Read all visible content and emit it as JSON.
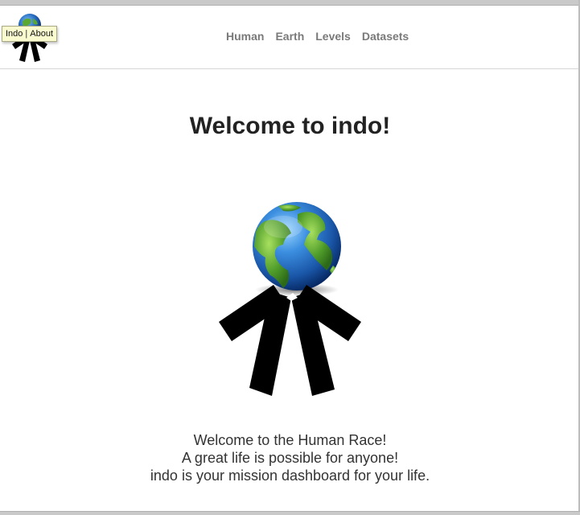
{
  "tooltip": {
    "left": "Indo",
    "separator": "|",
    "right": "About"
  },
  "nav": {
    "items": [
      {
        "label": "Human"
      },
      {
        "label": "Earth"
      },
      {
        "label": "Levels"
      },
      {
        "label": "Datasets"
      }
    ]
  },
  "main": {
    "title": "Welcome to indo!",
    "lines": [
      "Welcome to the Human Race!",
      "A great life is possible for anyone!",
      "indo is your mission dashboard for your life."
    ]
  },
  "colors": {
    "nav_text": "#7a7a7a",
    "title_text": "#222222",
    "tooltip_bg": "#fbfbd0",
    "globe_ocean": "#1e63b8",
    "globe_land": "#5aa832",
    "figure": "#000000"
  },
  "icons": {
    "header_logo": "indo-globe-figure-icon",
    "hero_logo": "indo-globe-figure-icon"
  }
}
